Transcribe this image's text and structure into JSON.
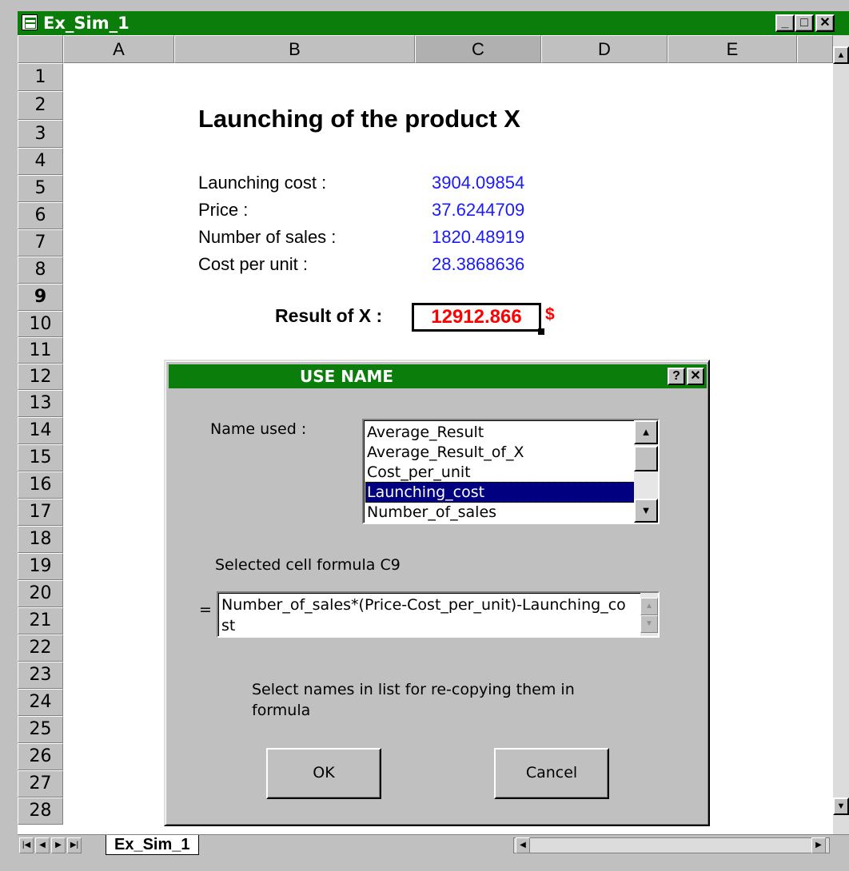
{
  "window": {
    "title": "Ex_Sim_1",
    "minimize": "_",
    "maximize": "□",
    "close": "✕"
  },
  "columns": [
    "A",
    "B",
    "C",
    "D",
    "E"
  ],
  "rows": [
    "1",
    "2",
    "3",
    "4",
    "5",
    "6",
    "7",
    "8",
    "9",
    "10",
    "11",
    "12",
    "13",
    "14",
    "15",
    "16",
    "17",
    "18",
    "19",
    "20",
    "21",
    "22",
    "23",
    "24",
    "25",
    "26",
    "27",
    "28"
  ],
  "sheet": {
    "title": "Launching of the product X",
    "rows": [
      {
        "label": "Launching cost :",
        "value": "3904.09854"
      },
      {
        "label": "Price :",
        "value": "37.6244709"
      },
      {
        "label": "Number of sales :",
        "value": "1820.48919"
      },
      {
        "label": "Cost per unit :",
        "value": "28.3868636"
      }
    ],
    "result_label": "Result of X :",
    "result_value": "12912.866",
    "currency": "$",
    "tab_name": "Ex_Sim_1"
  },
  "dialog": {
    "title": "USE NAME",
    "help": "?",
    "close": "✕",
    "name_used_label": "Name used :",
    "names": [
      "Average_Result",
      "Average_Result_of_X",
      "Cost_per_unit",
      "Launching_cost",
      "Number_of_sales"
    ],
    "selected_index": 3,
    "formula_label": "Selected cell formula C9",
    "equals": "=",
    "formula": "Number_of_sales*(Price-Cost_per_unit)-Launching_cost",
    "hint": "Select names in list for re-copying them in formula",
    "ok": "OK",
    "cancel": "Cancel"
  },
  "colors": {
    "title_bar": "#0a7d0a",
    "value_text": "#1a1aff",
    "result_text": "#ff0000",
    "selection": "#000080"
  }
}
